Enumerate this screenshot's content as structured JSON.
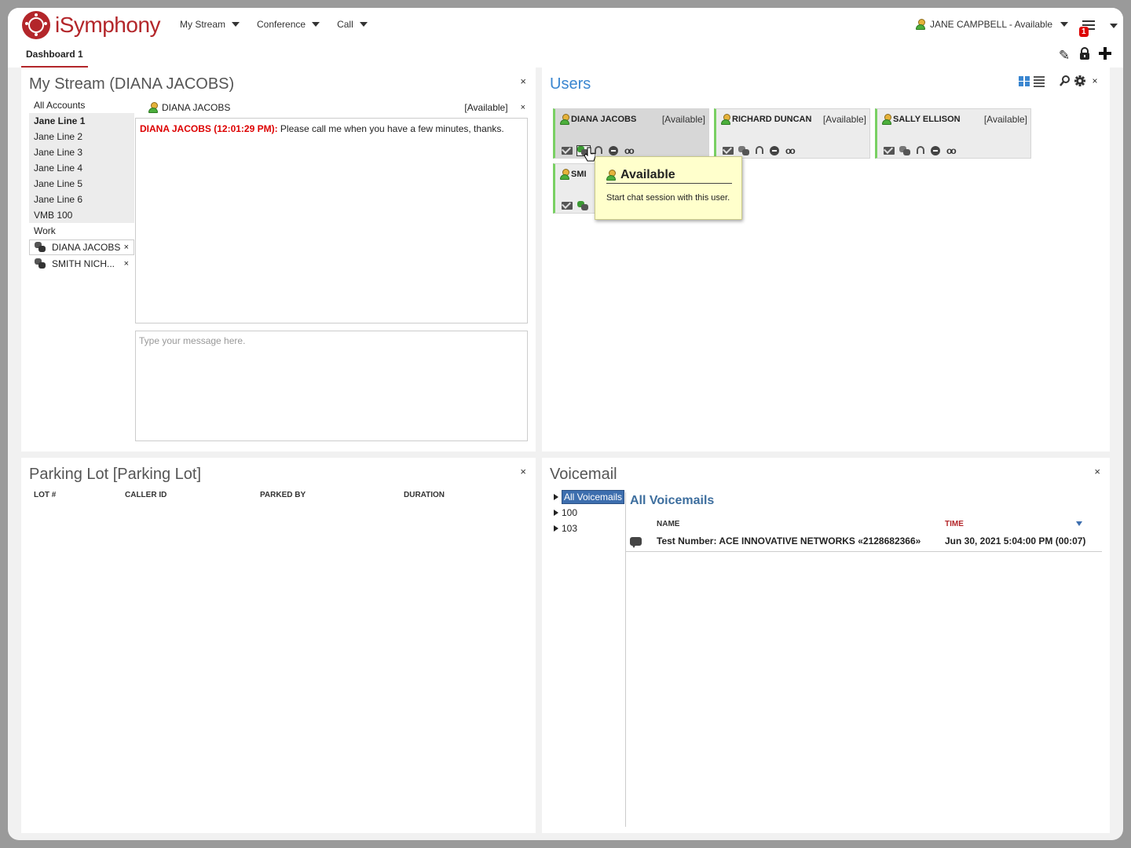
{
  "app": {
    "logo_text": "iSymphony",
    "menus": [
      "My Stream",
      "Conference",
      "Call"
    ],
    "user_status": "JANE CAMPBELL - Available",
    "notification_count": "1",
    "colors": {
      "brand": "#b3262a",
      "accent": "#3a86d0",
      "available": "#79d063"
    }
  },
  "tabs": [
    {
      "label": "Dashboard 1",
      "active": true
    }
  ],
  "toolbar_icons": [
    "pencil-icon",
    "lock-icon",
    "plus-icon"
  ],
  "my_stream": {
    "title": "My Stream (DIANA JACOBS)",
    "accounts": [
      {
        "label": "All Accounts",
        "style": "plain"
      },
      {
        "label": "Jane Line 1",
        "style": "selected"
      },
      {
        "label": "Jane Line 2",
        "style": "grey"
      },
      {
        "label": "Jane Line 3",
        "style": "grey"
      },
      {
        "label": "Jane Line 4",
        "style": "grey"
      },
      {
        "label": "Jane Line 5",
        "style": "grey"
      },
      {
        "label": "Jane Line 6",
        "style": "grey"
      },
      {
        "label": "VMB 100",
        "style": "grey"
      },
      {
        "label": "Work",
        "style": "plain"
      }
    ],
    "chats": [
      {
        "label": "DIANA JACOBS",
        "close": "×"
      },
      {
        "label": "SMITH NICH...",
        "close": "×"
      }
    ],
    "conversation": {
      "user": "DIANA JACOBS",
      "status": "[Available]",
      "close": "×",
      "messages": [
        {
          "sender": "DIANA JACOBS (12:01:29 PM):",
          "text": " Please call me when you have a few minutes, thanks."
        }
      ]
    },
    "input_placeholder": "Type your message here."
  },
  "users": {
    "title": "Users",
    "cards": [
      {
        "name": "DIANA JACOBS",
        "status": "[Available]"
      },
      {
        "name": "RICHARD DUNCAN",
        "status": "[Available]"
      },
      {
        "name": "SALLY ELLISON",
        "status": "[Available]"
      },
      {
        "name": "SMI",
        "status": ""
      }
    ],
    "tooltip": {
      "title": "Available",
      "description": "Start chat session with this user."
    }
  },
  "parking_lot": {
    "title": "Parking Lot [Parking Lot]",
    "columns": [
      "LOT #",
      "CALLER ID",
      "PARKED BY",
      "DURATION"
    ]
  },
  "voicemail": {
    "title": "Voicemail",
    "tree": [
      {
        "label": "All Voicemails",
        "selected": true
      },
      {
        "label": "100",
        "selected": false
      },
      {
        "label": "103",
        "selected": false
      }
    ],
    "heading": "All Voicemails",
    "columns": {
      "name": "NAME",
      "time": "TIME"
    },
    "rows": [
      {
        "name": "Test Number: ACE INNOVATIVE NETWORKS «2128682366»",
        "time": "Jun 30, 2021 5:04:00 PM (00:07)"
      }
    ]
  }
}
